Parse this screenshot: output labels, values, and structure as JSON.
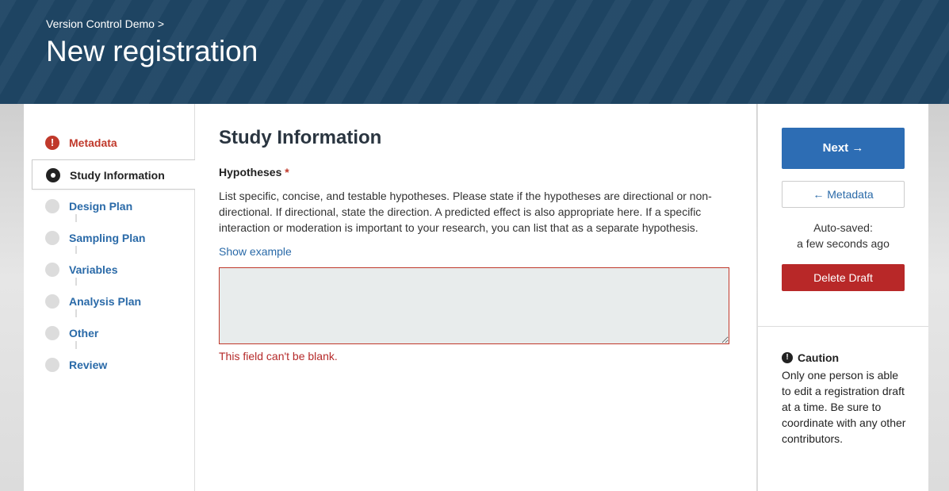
{
  "header": {
    "breadcrumb": "Version Control Demo >",
    "title": "New registration"
  },
  "steps": [
    {
      "label": "Metadata",
      "state": "error"
    },
    {
      "label": "Study Information",
      "state": "active"
    },
    {
      "label": "Design Plan",
      "state": "pending"
    },
    {
      "label": "Sampling Plan",
      "state": "pending"
    },
    {
      "label": "Variables",
      "state": "pending"
    },
    {
      "label": "Analysis Plan",
      "state": "pending"
    },
    {
      "label": "Other",
      "state": "pending"
    },
    {
      "label": "Review",
      "state": "pending"
    }
  ],
  "main": {
    "section_title": "Study Information",
    "field_label": "Hypotheses",
    "required_marker": "*",
    "help_text": "List specific, concise, and testable hypotheses. Please state if the hypotheses are directional or non-directional. If directional, state the direction. A predicted effect is also appropriate here. If a specific interaction or moderation is important to your research, you can list that as a separate hypothesis.",
    "show_example": "Show example",
    "textarea_value": "",
    "error": "This field can't be blank."
  },
  "sidebar_right": {
    "next_label": "Next →",
    "prev_label": "← Metadata",
    "autosave_label": "Auto-saved:",
    "autosave_time": "a few seconds ago",
    "delete_label": "Delete Draft",
    "caution_title": "Caution",
    "caution_text": "Only one person is able to edit a registration draft at a time. Be sure to coordinate with any other contributors."
  },
  "colors": {
    "header_bg": "#1f4665",
    "link": "#2a6aa8",
    "error": "#c0392b",
    "primary_button": "#2d6db4",
    "danger_button": "#b82828"
  }
}
